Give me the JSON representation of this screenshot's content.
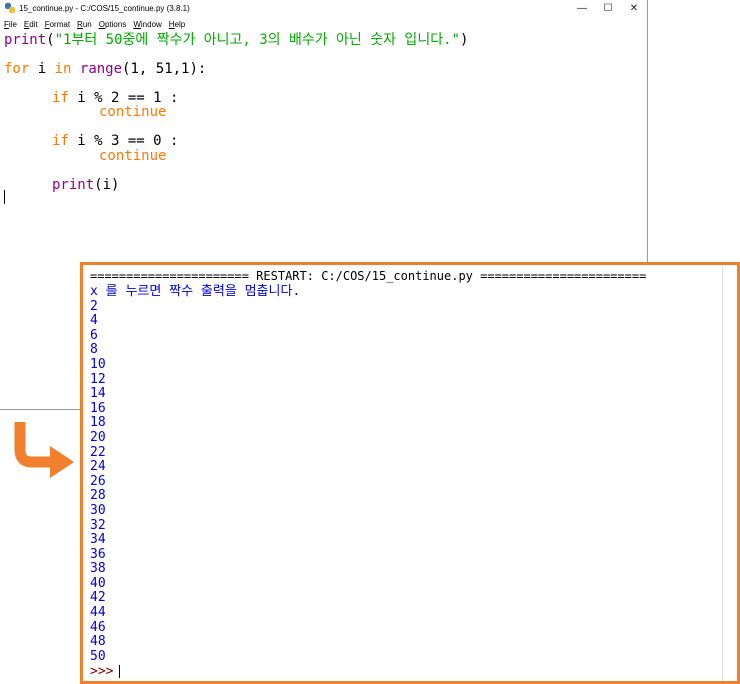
{
  "editor": {
    "title": "15_continue.py - C:/COS/15_continue.py (3.8.1)",
    "window_controls": {
      "minimize": "—",
      "maximize": "☐",
      "close": "✕"
    },
    "menu": [
      {
        "first": "F",
        "rest": "ile"
      },
      {
        "first": "E",
        "rest": "dit"
      },
      {
        "first": "F",
        "rest": "ormat"
      },
      {
        "first": "R",
        "rest": "un"
      },
      {
        "first": "O",
        "rest": "ptions"
      },
      {
        "first": "W",
        "rest": "indow"
      },
      {
        "first": "H",
        "rest": "elp"
      }
    ],
    "code": {
      "l1": {
        "fn": "print",
        "p1": "(",
        "str": "\"1부터 50중에 짝수가 아니고, 3의 배수가 아닌 숫자 입니다.\"",
        "p2": ")"
      },
      "l2": {
        "kw1": "for",
        "v": " i ",
        "kw2": "in",
        "sp": " ",
        "fn": "range",
        "args": "(1, 51,1):"
      },
      "l3": {
        "kw": "if",
        "rest": " i % 2 == 1 :"
      },
      "l4": {
        "kw": "continue"
      },
      "l5": {
        "kw": "if",
        "rest": " i % 3 == 0 :"
      },
      "l6": {
        "kw": "continue"
      },
      "l7": {
        "fn": "print",
        "rest": "(i)"
      }
    }
  },
  "shell": {
    "restart_line": "====================== RESTART: C:/COS/15_continue.py =======================",
    "message": "x 를 누르면 짝수 출력을 멈춥니다.",
    "outputs": [
      "2",
      "4",
      "6",
      "8",
      "10",
      "12",
      "14",
      "16",
      "18",
      "20",
      "22",
      "24",
      "26",
      "28",
      "30",
      "32",
      "34",
      "36",
      "38",
      "40",
      "42",
      "44",
      "46",
      "48",
      "50"
    ],
    "prompt": ">>>"
  },
  "colors": {
    "keyword": "#ff7700",
    "builtin": "#900090",
    "string": "#00aa00",
    "output": "#0000d8",
    "highlight_border": "#f07f2e"
  }
}
